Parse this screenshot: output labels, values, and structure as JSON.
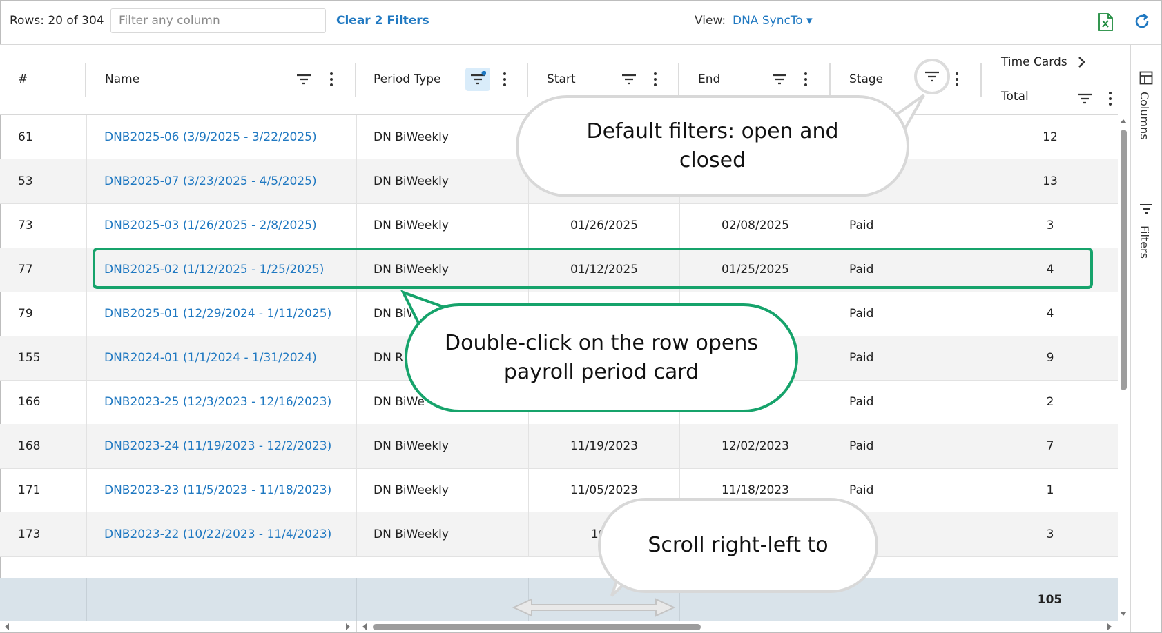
{
  "toolbar": {
    "rows_count": "Rows: 20 of 304",
    "filter_placeholder": "Filter any column",
    "clear_filters": "Clear 2 Filters",
    "view_label": "View:",
    "view_value": "DNA SyncTo ▾"
  },
  "columns": {
    "num": "#",
    "name": "Name",
    "period_type": "Period Type",
    "start": "Start",
    "end": "End",
    "stage": "Stage",
    "time_cards": "Time Cards",
    "total": "Total"
  },
  "rows": [
    {
      "num": "61",
      "name": "DNB2025-06 (3/9/2025 - 3/22/2025)",
      "period_type": "DN BiWeekly",
      "start": "",
      "end": "",
      "stage": "",
      "total": "12"
    },
    {
      "num": "53",
      "name": "DNB2025-07 (3/23/2025 - 4/5/2025)",
      "period_type": "DN BiWeekly",
      "start": "",
      "end": "",
      "stage": "",
      "total": "13"
    },
    {
      "num": "73",
      "name": "DNB2025-03 (1/26/2025 - 2/8/2025)",
      "period_type": "DN BiWeekly",
      "start": "01/26/2025",
      "end": "02/08/2025",
      "stage": "Paid",
      "total": "3"
    },
    {
      "num": "77",
      "name": "DNB2025-02 (1/12/2025 - 1/25/2025)",
      "period_type": "DN BiWeekly",
      "start": "01/12/2025",
      "end": "01/25/2025",
      "stage": "Paid",
      "total": "4"
    },
    {
      "num": "79",
      "name": "DNB2025-01 (12/29/2024 - 1/11/2025)",
      "period_type": "DN BiW",
      "start": "",
      "end": "025",
      "stage": "Paid",
      "total": "4"
    },
    {
      "num": "155",
      "name": "DNR2024-01 (1/1/2024 - 1/31/2024)",
      "period_type": "DN R",
      "start": "",
      "end": "",
      "stage": "Paid",
      "total": "9"
    },
    {
      "num": "166",
      "name": "DNB2023-25 (12/3/2023 - 12/16/2023)",
      "period_type": "DN BiWe",
      "start": "",
      "end": "023",
      "stage": "Paid",
      "total": "2"
    },
    {
      "num": "168",
      "name": "DNB2023-24 (11/19/2023 - 12/2/2023)",
      "period_type": "DN BiWeekly",
      "start": "11/19/2023",
      "end": "12/02/2023",
      "stage": "Paid",
      "total": "7"
    },
    {
      "num": "171",
      "name": "DNB2023-23 (11/5/2023 - 11/18/2023)",
      "period_type": "DN BiWeekly",
      "start": "11/05/2023",
      "end": "11/18/2023",
      "stage": "Paid",
      "total": "1"
    },
    {
      "num": "173",
      "name": "DNB2023-22 (10/22/2023 - 11/4/2023)",
      "period_type": "DN BiWeekly",
      "start": "10/2",
      "end": "",
      "stage": "",
      "total": "3"
    }
  ],
  "footer": {
    "total": "105"
  },
  "side_panel": {
    "columns": "Columns",
    "filters": "Filters"
  },
  "callouts": {
    "filters_line1": "Default filters: open and",
    "filters_line2": "closed",
    "double_click_line1": "Double-click on the row opens",
    "double_click_line2": "payroll period card",
    "scroll": "Scroll right-left to"
  },
  "colors": {
    "link": "#1f78c1",
    "accent_green": "#16a36b",
    "footer_bg": "#d9e3ea"
  }
}
